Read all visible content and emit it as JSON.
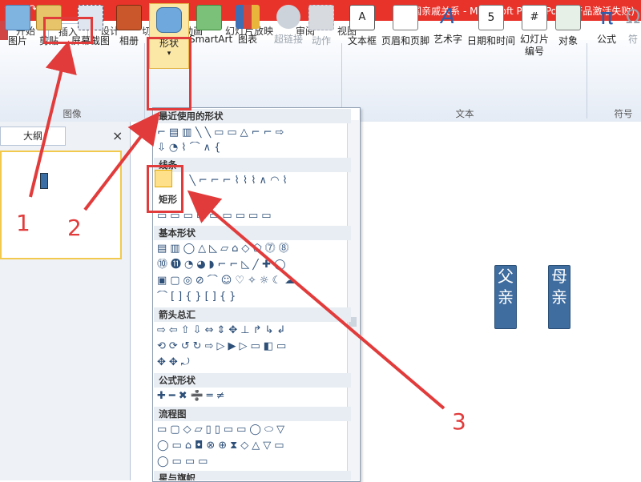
{
  "window": {
    "title": "中国亲戚关系 - Microsoft PowerPoint(产品激活失败)"
  },
  "tabs": [
    "开始",
    "插入",
    "设计",
    "切换",
    "动画",
    "幻灯片放映",
    "审阅",
    "视图"
  ],
  "ribbon": {
    "buttons": {
      "picture": "图片",
      "clipart": "剪贴",
      "screenshot": "屏幕截图",
      "album": "相册",
      "shapes": "形状",
      "smartart": "SmartArt",
      "chart": "图表",
      "hyperlink": "超链接",
      "action": "动作",
      "textbox": "文本框",
      "header_footer": "页眉和页脚",
      "wordart": "艺术字",
      "datetime": "日期和时间",
      "slide_number": "幻灯片\n编号",
      "object": "对象",
      "equation": "公式",
      "symbol": "符"
    },
    "groups": {
      "images": "图像",
      "text": "文本",
      "symbols": "符号"
    }
  },
  "left_pane": {
    "tab": "大纲",
    "close": "×"
  },
  "slide": {
    "boxes": [
      "父亲",
      "母亲"
    ]
  },
  "shapes_menu": {
    "sections": [
      "最近使用的形状",
      "线条",
      "矩形",
      "基本形状",
      "箭头总汇",
      "公式形状",
      "流程图",
      "星与旗帜"
    ],
    "rows": {
      "recent1": "⌐▤▥╲╲▭▭△⌐⌐⇨",
      "recent2": "⇩◔⌇⌒∧{",
      "lines": "╲⌐⌐⌐⌇⌇⌇∧◠⌇",
      "rect": "▭▭▭▭▭▭▭▭▭",
      "basic1": "▤▥◯△◺▱⌂◇⬠⓻⓼",
      "basic2": "⓾⓫◔◕◗⌐⌐◺╱✚◯",
      "basic3": "▣▢◎⊘⌒☺♡✧☼☾☁",
      "basic4": "⌒[]{}[]{}",
      "arrow1": "⇨⇦⇧⇩⇔⇕✥⊥↱↳↲",
      "arrow2": "⟲⟳↺↻⇨▷▶▷▭◧▭",
      "arrow3": "✥✥⤾",
      "math": "✚━✖➗═≠",
      "flow1": "▭▢◇▱▯▯▭▭◯⬭▽",
      "flow2": "◯▭⌂◘⊗⊕⧗◇△▽▭",
      "flow3": "◯▭▭▭"
    }
  },
  "annotations": {
    "n1": "1",
    "n2": "2",
    "n3": "3"
  },
  "colors": {
    "title_bar": "#e8332b",
    "annotation": "#e23b3b",
    "box_fill": "#3f6d9f"
  }
}
